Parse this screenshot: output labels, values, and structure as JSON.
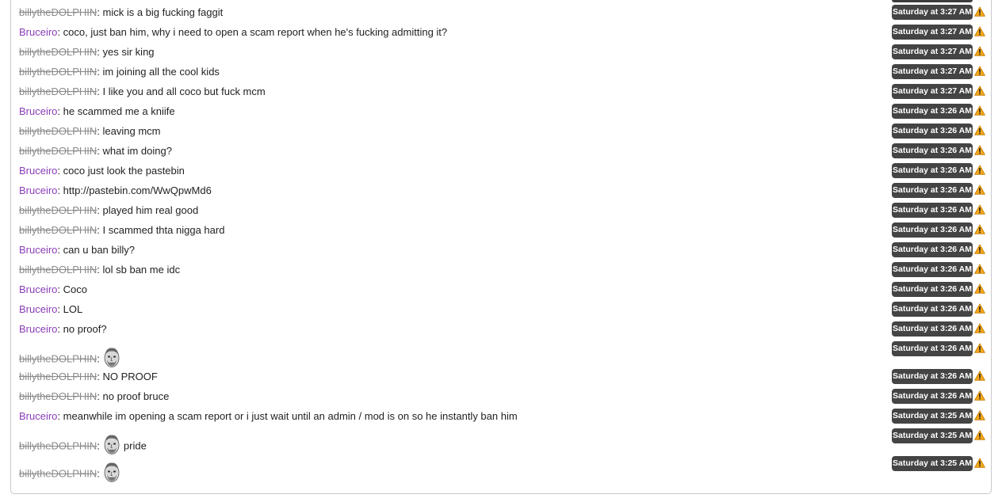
{
  "messages": [
    {
      "user": "billytheDOLPHIN",
      "kind": "billy",
      "text": "mick is a big fucking faggit",
      "time": "Saturday at 3:27 AM",
      "emote": false
    },
    {
      "user": "Bruceiro",
      "kind": "bruce",
      "text": "coco, just ban him, why i need to open a scam report when he's fucking admitting it?",
      "time": "Saturday at 3:27 AM",
      "emote": false
    },
    {
      "user": "billytheDOLPHIN",
      "kind": "billy",
      "text": "yes sir king",
      "time": "Saturday at 3:27 AM",
      "emote": false
    },
    {
      "user": "billytheDOLPHIN",
      "kind": "billy",
      "text": "im joining all the cool kids",
      "time": "Saturday at 3:27 AM",
      "emote": false
    },
    {
      "user": "billytheDOLPHIN",
      "kind": "billy",
      "text": "I like you and all coco but fuck mcm",
      "time": "Saturday at 3:27 AM",
      "emote": false
    },
    {
      "user": "Bruceiro",
      "kind": "bruce",
      "text": "he scammed me a kniife",
      "time": "Saturday at 3:26 AM",
      "emote": false
    },
    {
      "user": "billytheDOLPHIN",
      "kind": "billy",
      "text": "leaving mcm",
      "time": "Saturday at 3:26 AM",
      "emote": false
    },
    {
      "user": "billytheDOLPHIN",
      "kind": "billy",
      "text": "what im doing?",
      "time": "Saturday at 3:26 AM",
      "emote": false
    },
    {
      "user": "Bruceiro",
      "kind": "bruce",
      "text": "coco just look the pastebin",
      "time": "Saturday at 3:26 AM",
      "emote": false
    },
    {
      "user": "Bruceiro",
      "kind": "bruce",
      "text": "http://pastebin.com/WwQpwMd6",
      "time": "Saturday at 3:26 AM",
      "emote": false
    },
    {
      "user": "billytheDOLPHIN",
      "kind": "billy",
      "text": "played him real good",
      "time": "Saturday at 3:26 AM",
      "emote": false
    },
    {
      "user": "billytheDOLPHIN",
      "kind": "billy",
      "text": "I scammed thta nigga hard",
      "time": "Saturday at 3:26 AM",
      "emote": false
    },
    {
      "user": "Bruceiro",
      "kind": "bruce",
      "text": "can u ban billy?",
      "time": "Saturday at 3:26 AM",
      "emote": false
    },
    {
      "user": "billytheDOLPHIN",
      "kind": "billy",
      "text": "lol sb ban me idc",
      "time": "Saturday at 3:26 AM",
      "emote": false
    },
    {
      "user": "Bruceiro",
      "kind": "bruce",
      "text": "Coco",
      "time": "Saturday at 3:26 AM",
      "emote": false
    },
    {
      "user": "Bruceiro",
      "kind": "bruce",
      "text": "LOL",
      "time": "Saturday at 3:26 AM",
      "emote": false
    },
    {
      "user": "Bruceiro",
      "kind": "bruce",
      "text": "no proof?",
      "time": "Saturday at 3:26 AM",
      "emote": false
    },
    {
      "user": "billytheDOLPHIN",
      "kind": "billy",
      "text": "",
      "time": "Saturday at 3:26 AM",
      "emote": true
    },
    {
      "user": "billytheDOLPHIN",
      "kind": "billy",
      "text": "NO PROOF",
      "time": "Saturday at 3:26 AM",
      "emote": false
    },
    {
      "user": "billytheDOLPHIN",
      "kind": "billy",
      "text": "no proof bruce",
      "time": "Saturday at 3:26 AM",
      "emote": false
    },
    {
      "user": "Bruceiro",
      "kind": "bruce",
      "text": "meanwhile im opening a scam report or i just wait until an admin / mod is on so he instantly ban him",
      "time": "Saturday at 3:25 AM",
      "emote": false
    },
    {
      "user": "billytheDOLPHIN",
      "kind": "billy",
      "text": "pride",
      "time": "Saturday at 3:25 AM",
      "emote": true
    },
    {
      "user": "billytheDOLPHIN",
      "kind": "billy",
      "text": "",
      "time": "Saturday at 3:25 AM",
      "emote": true
    }
  ],
  "icons": {
    "warning": "warning-icon",
    "emote": "face-emote-icon"
  },
  "colors": {
    "bruce_name": "#8a3db8",
    "billy_name": "#8a8a8a",
    "badge_bg": "#444444",
    "warning": "#f0a500"
  }
}
